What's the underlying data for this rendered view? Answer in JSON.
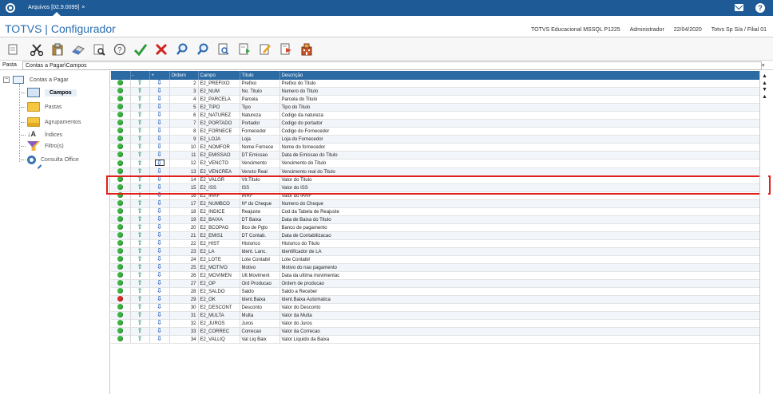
{
  "tab": {
    "title": "Arquivos [02.9.0099]",
    "close": "×"
  },
  "title_bar": {
    "app_title": "TOTVS | Configurador",
    "environment": "TOTVS Educacional MSSQL P1225",
    "user": "Administrador",
    "date": "22/04/2020",
    "company": "Totvs Sp S/a / Filial 01"
  },
  "breadcrumb": {
    "label": "Pasta",
    "path": "Contas a Pagar\\Campos"
  },
  "tree": {
    "root": "Contas a Pagar",
    "items": [
      {
        "label": "Campos",
        "icon": "calendar-icon",
        "selected": true
      },
      {
        "label": "Pastas",
        "icon": "folder-icon"
      },
      {
        "label": "Agrupamentos",
        "icon": "folder-group-icon"
      },
      {
        "label": "Índices",
        "icon": "sort-az-icon"
      },
      {
        "label": "Filtro(s)",
        "icon": "filter-icon"
      },
      {
        "label": "Consulta Office",
        "icon": "magnifier-icon"
      }
    ]
  },
  "grid": {
    "columns": [
      "",
      "-",
      "+",
      "Ordem",
      "Campo",
      "Título",
      "Descrição"
    ],
    "rows": [
      {
        "status": "green",
        "ordem": "2",
        "campo": "E2_PREFIXO",
        "titulo": "Prefixo",
        "descricao": "Prefixo do Titulo"
      },
      {
        "status": "green",
        "ordem": "3",
        "campo": "E2_NUM",
        "titulo": "No. Titulo",
        "descricao": "Numero do Titulo"
      },
      {
        "status": "green",
        "ordem": "4",
        "campo": "E2_PARCELA",
        "titulo": "Parcela",
        "descricao": "Parcela do Titulo"
      },
      {
        "status": "green",
        "ordem": "5",
        "campo": "E2_TIPO",
        "titulo": "Tipo",
        "descricao": "Tipo do Titulo"
      },
      {
        "status": "green",
        "ordem": "6",
        "campo": "E2_NATUREZ",
        "titulo": "Natureza",
        "descricao": "Codigo da natureza"
      },
      {
        "status": "green",
        "ordem": "7",
        "campo": "E2_PORTADO",
        "titulo": "Portador",
        "descricao": "Codigo do portador"
      },
      {
        "status": "green",
        "ordem": "8",
        "campo": "E2_FORNECE",
        "titulo": "Fornecedor",
        "descricao": "Codigo do Fornecedor"
      },
      {
        "status": "green",
        "ordem": "9",
        "campo": "E2_LOJA",
        "titulo": "Loja",
        "descricao": "Loja do Fornecedor"
      },
      {
        "status": "green",
        "ordem": "10",
        "campo": "E2_NOMFOR",
        "titulo": "Nome Fornece",
        "descricao": "Nome do fornecedor"
      },
      {
        "status": "green",
        "ordem": "11",
        "campo": "E2_EMISSAO",
        "titulo": "DT Emissao",
        "descricao": "Data de Emissao do Titulo"
      },
      {
        "status": "green",
        "ordem": "12",
        "campo": "E2_VENCTO",
        "titulo": "Vencimento",
        "descricao": "Vencimento do Titulo",
        "selected": true
      },
      {
        "status": "green",
        "ordem": "13",
        "campo": "E2_VENCREA",
        "titulo": "Vencto Real",
        "descricao": "Vencimento real do Titulo"
      },
      {
        "status": "green",
        "ordem": "14",
        "campo": "E2_VALOR",
        "titulo": "Vlr.Titulo",
        "descricao": "Valor do Titulo"
      },
      {
        "status": "green",
        "ordem": "15",
        "campo": "E2_ISS",
        "titulo": "ISS",
        "descricao": "Valor do ISS"
      },
      {
        "status": "green",
        "ordem": "16",
        "campo": "E2_IRRF",
        "titulo": "IRRF",
        "descricao": "Valor do IRRF"
      },
      {
        "status": "green",
        "ordem": "17",
        "campo": "E2_NUMBCO",
        "titulo": "Nº do Cheque",
        "descricao": "Numero do Cheque"
      },
      {
        "status": "green",
        "ordem": "18",
        "campo": "E2_INDICE",
        "titulo": "Reajuste",
        "descricao": "Cod da Tabela de Reajuste"
      },
      {
        "status": "green",
        "ordem": "19",
        "campo": "E2_BAIXA",
        "titulo": "DT Baixa",
        "descricao": "Data de Baixa do Titulo"
      },
      {
        "status": "green",
        "ordem": "20",
        "campo": "E2_BCOPAG",
        "titulo": "Bco de Pgto",
        "descricao": "Banco de pagamento"
      },
      {
        "status": "green",
        "ordem": "21",
        "campo": "E2_EMIS1",
        "titulo": "DT Contab.",
        "descricao": "Data de Contabilizacao"
      },
      {
        "status": "green",
        "ordem": "22",
        "campo": "E2_HIST",
        "titulo": "Historico",
        "descricao": "Historico do Titulo"
      },
      {
        "status": "green",
        "ordem": "23",
        "campo": "E2_LA",
        "titulo": "Ident. Lanc.",
        "descricao": "Identificador de LA"
      },
      {
        "status": "green",
        "ordem": "24",
        "campo": "E2_LOTE",
        "titulo": "Lote Contabil",
        "descricao": "Lote Contabil"
      },
      {
        "status": "green",
        "ordem": "25",
        "campo": "E2_MOTIVO",
        "titulo": "Motivo",
        "descricao": "Motivo do nao pagamento"
      },
      {
        "status": "green",
        "ordem": "26",
        "campo": "E2_MOVIMEN",
        "titulo": "Ult.Moviment",
        "descricao": "Data da ultima movimentac"
      },
      {
        "status": "green",
        "ordem": "27",
        "campo": "E2_OP",
        "titulo": "Ord Producao",
        "descricao": "Ordem de producao"
      },
      {
        "status": "green",
        "ordem": "28",
        "campo": "E2_SALDO",
        "titulo": "Saldo",
        "descricao": "Saldo a Receber"
      },
      {
        "status": "red",
        "ordem": "29",
        "campo": "E2_OK",
        "titulo": "Ident.Baixa",
        "descricao": "Ident.Baixa Automatica"
      },
      {
        "status": "green",
        "ordem": "30",
        "campo": "E2_DESCONT",
        "titulo": "Desconto",
        "descricao": "Valor do Desconto"
      },
      {
        "status": "green",
        "ordem": "31",
        "campo": "E2_MULTA",
        "titulo": "Multa",
        "descricao": "Valor da Multa"
      },
      {
        "status": "green",
        "ordem": "32",
        "campo": "E2_JUROS",
        "titulo": "Juros",
        "descricao": "Valor do Juros"
      },
      {
        "status": "green",
        "ordem": "33",
        "campo": "E2_CORREC",
        "titulo": "Correcao",
        "descricao": "Valor da Correcao"
      },
      {
        "status": "green",
        "ordem": "34",
        "campo": "E2_VALLIQ",
        "titulo": "Val Liq Baix",
        "descricao": "Valor Liquido da Baixa"
      }
    ]
  },
  "colors": {
    "brand": "#1d5a96",
    "header": "#2b6aa3",
    "highlight": "#e0211b"
  }
}
